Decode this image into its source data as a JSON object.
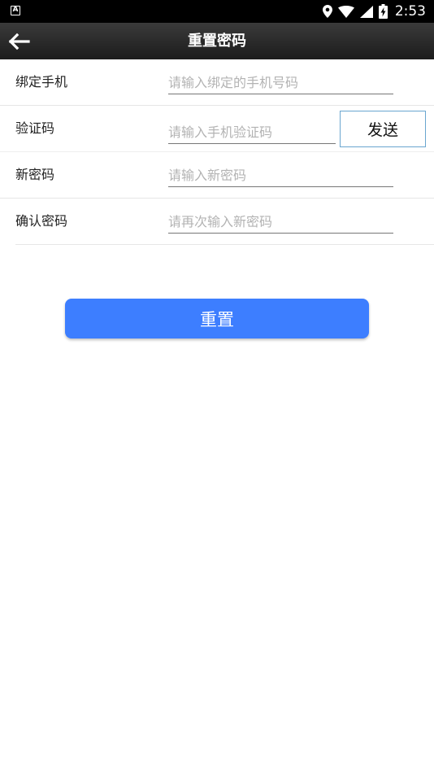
{
  "status_bar": {
    "time": "2:53",
    "notification_icon": "notification-a-icon",
    "icons": [
      "location-icon",
      "wifi-icon",
      "cell-signal-icon",
      "battery-charging-icon"
    ]
  },
  "app_bar": {
    "title": "重置密码",
    "back_icon": "arrow-left-icon"
  },
  "form": {
    "phone": {
      "label": "绑定手机",
      "placeholder": "请输入绑定的手机号码",
      "value": ""
    },
    "code": {
      "label": "验证码",
      "placeholder": "请输入手机验证码",
      "value": "",
      "send_label": "发送"
    },
    "new_password": {
      "label": "新密码",
      "placeholder": "请输入新密码",
      "value": ""
    },
    "confirm_password": {
      "label": "确认密码",
      "placeholder": "请再次输入新密码",
      "value": ""
    }
  },
  "reset_button": {
    "label": "重置",
    "color": "#3d7eff"
  }
}
